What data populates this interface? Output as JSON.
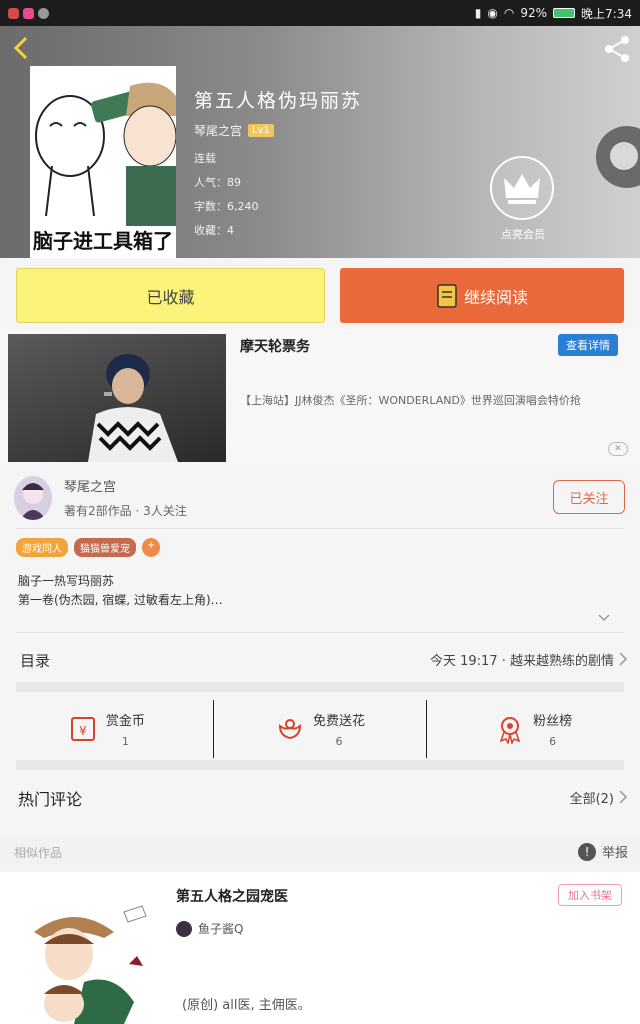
{
  "status_bar": {
    "battery": "92%",
    "time": "晚上7:34"
  },
  "book": {
    "title": "第五人格伪玛丽苏",
    "cover_caption": "脑子进工具箱了",
    "author": "琴尾之宫",
    "author_level": "Lv1",
    "status": "连载",
    "popularity_label": "人气：",
    "popularity": "89",
    "words_label": "字数：",
    "words": "6,240",
    "favorites_label": "收藏：",
    "favorites": "4",
    "vip_label": "点亮会员"
  },
  "buttons": {
    "favorited": "已收藏",
    "continue": "继续阅读"
  },
  "ad": {
    "title": "摩天轮票务",
    "detail_label": "查看详情",
    "description": "【上海站】JJ林俊杰《圣所：WONDERLAND》世界巡回演唱会特价抢",
    "close": "✕"
  },
  "author_row": {
    "name": "琴尾之宫",
    "meta": "著有2部作品 · 3人关注",
    "follow_label": "已关注"
  },
  "tags": [
    {
      "label": "游戏同人",
      "color": "#f1a43c"
    },
    {
      "label": "猫猫兽爱宠",
      "color": "#c46a4e"
    },
    {
      "label": "+",
      "color": "#f08a4b"
    }
  ],
  "summary": {
    "line1": "脑子一热写玛丽苏",
    "line2": "第一卷(伪杰园, 宿蝶, 过敏看左上角)…"
  },
  "toc": {
    "label": "目录",
    "latest": "今天 19:17 · 越来越熟练的剧情"
  },
  "actions": [
    {
      "label": "赏金币",
      "count": "1",
      "icon": "red-envelope-icon"
    },
    {
      "label": "免费送花",
      "count": "6",
      "icon": "flower-icon"
    },
    {
      "label": "粉丝榜",
      "count": "6",
      "icon": "medal-icon"
    }
  ],
  "hot_comments": {
    "label": "热门评论",
    "all": "全部(2)"
  },
  "similar": {
    "label": "相似作品",
    "report": "举报"
  },
  "similar_work": {
    "title": "第五人格之园宠医",
    "add_label": "加入书架",
    "author": "鱼子酱Q",
    "description": "(原创) all医, 主佣医。"
  },
  "colors": {
    "accent_orange": "#e9693a",
    "favorite_yellow": "#fbf37a",
    "follow_red": "#e06848",
    "detail_blue": "#2a7fd4"
  }
}
